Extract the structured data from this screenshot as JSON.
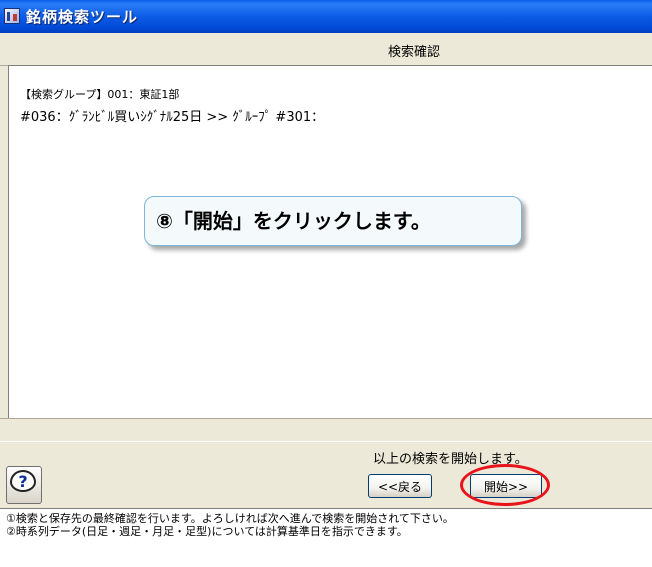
{
  "window": {
    "title": "銘柄検索ツール"
  },
  "header": {
    "title": "検索確認"
  },
  "content": {
    "group_line": "【検索グループ】001：東証1部",
    "condition_line": "#036：ｸﾞﾗﾝﾋﾞﾙ買いｼｸﾞﾅﾙ25日 >> ｸﾞﾙｰﾌﾟ #301："
  },
  "callout": {
    "text": "⑧「開始」をクリックします。"
  },
  "footer_area": {
    "confirm_text": "以上の検索を開始します。",
    "back_label": "<<戻る",
    "start_label": "開始>>",
    "help_symbol": "?"
  },
  "notes": [
    "①検索と保存先の最終確認を行います。よろしければ次へ進んで検索を開始されて下さい。",
    "②時系列データ(日足・週足・月足・足型)については計算基準日を指示できます。"
  ],
  "colors": {
    "titlebar": "#0a5de8",
    "highlight": "#e8141b",
    "callout_border": "#7fb7d8"
  }
}
